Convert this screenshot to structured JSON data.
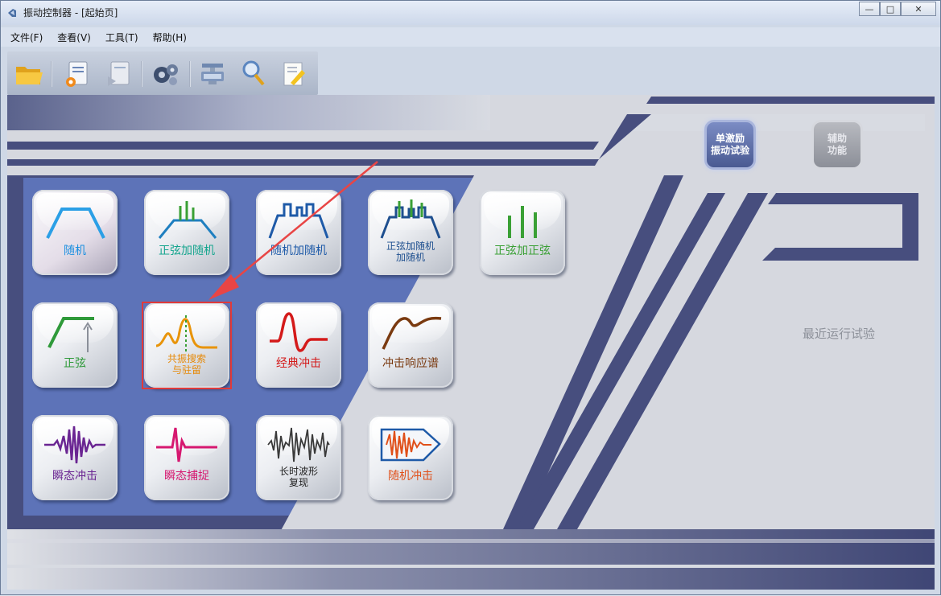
{
  "window": {
    "title": "振动控制器 - [起始页]"
  },
  "window_controls": {
    "minimize": "—",
    "maximize": "□",
    "close": "✕"
  },
  "menu": [
    "文件(F)",
    "查看(V)",
    "工具(T)",
    "帮助(H)"
  ],
  "toolbar": {
    "icons": [
      "folder-open-icon",
      "settings-document-icon",
      "run-document-icon",
      "gears-icon",
      "monitor-icon",
      "search-icon",
      "edit-document-icon"
    ]
  },
  "side_buttons": {
    "single_excite": "单激励\n振动试验",
    "aux": "辅助\n功能"
  },
  "recent": {
    "label": "最近运行试验"
  },
  "tiles": [
    {
      "label": "随机",
      "color": "#1a8fe0"
    },
    {
      "label": "正弦加随机",
      "color": "#15a58e"
    },
    {
      "label": "随机加随机",
      "color": "#1e5aa8"
    },
    {
      "label": "正弦加随机\n加随机",
      "color": "#1e4f8f"
    },
    {
      "label": "正弦加正弦",
      "color": "#3aa035"
    },
    {
      "label": "正弦",
      "color": "#2f9a3a"
    },
    {
      "label": "共振搜索\n与驻留",
      "color": "#e68a0a"
    },
    {
      "label": "经典冲击",
      "color": "#d41a1a"
    },
    {
      "label": "冲击响应谱",
      "color": "#7a3a10"
    },
    {
      "label": "瞬态冲击",
      "color": "#6a2592"
    },
    {
      "label": "瞬态捕捉",
      "color": "#d61870"
    },
    {
      "label": "长时波形\n复现",
      "color": "#222222"
    },
    {
      "label": "随机冲击",
      "color": "#e0501a"
    }
  ]
}
